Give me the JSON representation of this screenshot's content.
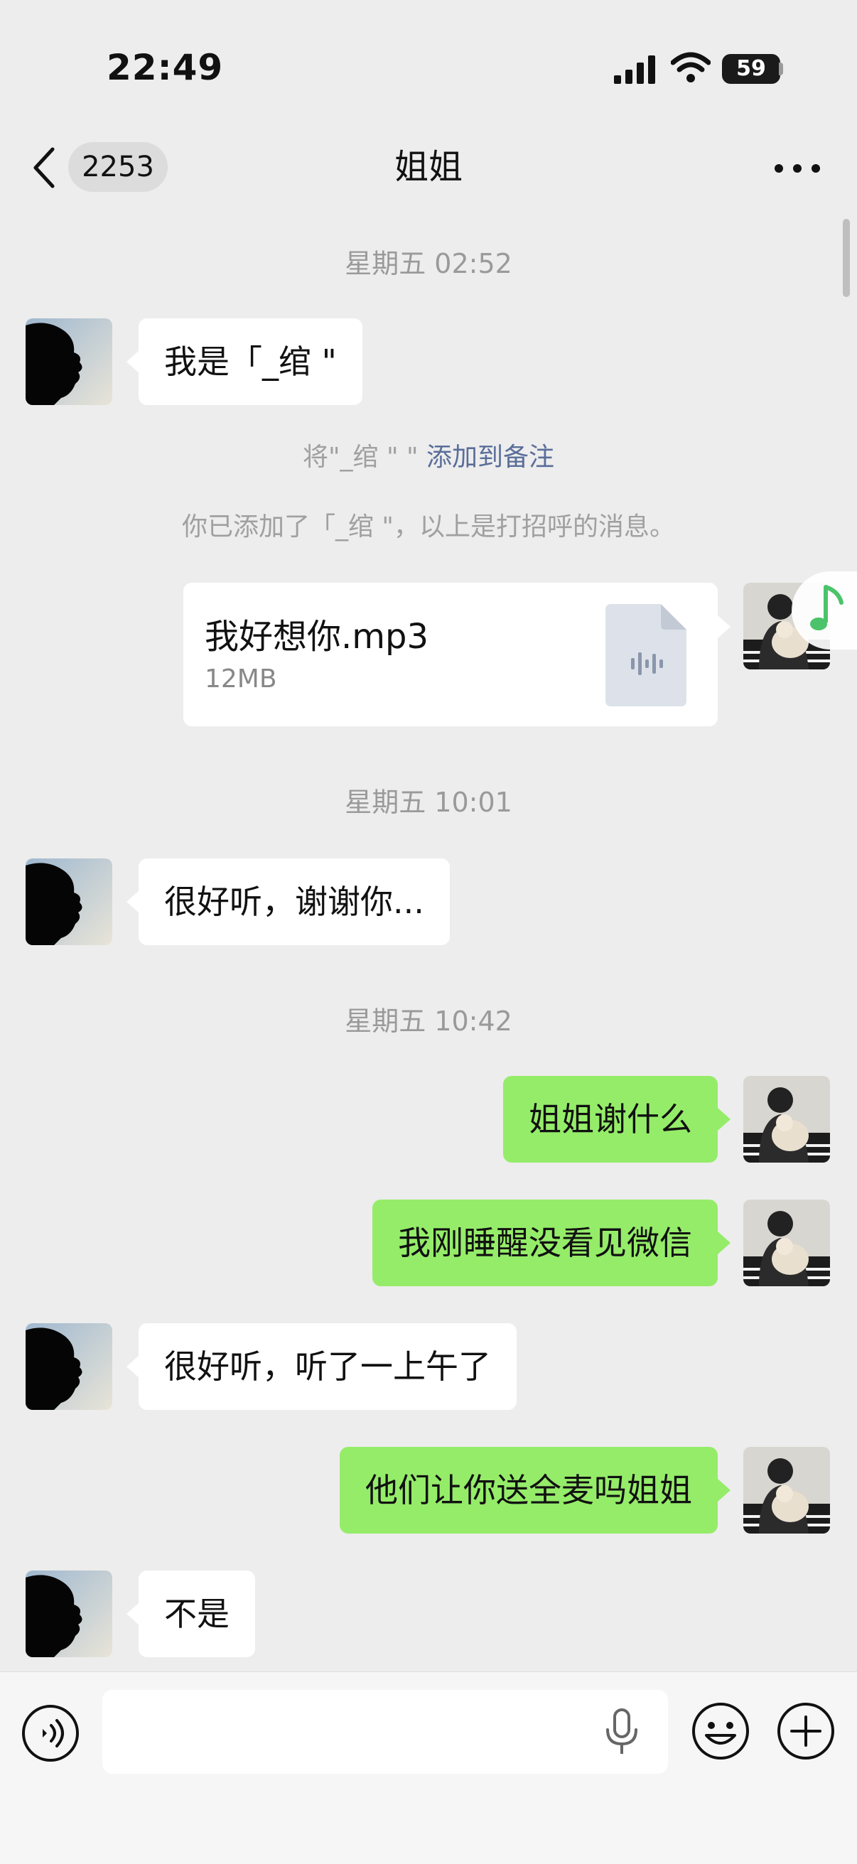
{
  "status_bar": {
    "time": "22:49",
    "battery": "59"
  },
  "header": {
    "unread_count": "2253",
    "title": "姐姐"
  },
  "messages": {
    "ts1": "星期五 02:52",
    "m1": "我是「_绾 \"",
    "sys1_prefix": "将\"_绾 \" \"",
    "sys1_link": "添加到备注",
    "sys2": "你已添加了「_绾 \"，以上是打招呼的消息。",
    "file_name": "我好想你.mp3",
    "file_size": "12MB",
    "ts2": "星期五 10:01",
    "m2": "很好听，谢谢你...",
    "ts3": "星期五 10:42",
    "m3": "姐姐谢什么",
    "m4": "我刚睡醒没看见微信",
    "m5": "很好听，听了一上午了",
    "m6": "他们让你送全麦吗姐姐",
    "m7": "不是"
  },
  "input": {
    "value": "",
    "placeholder": ""
  },
  "icons": [
    "back-icon",
    "more-icon",
    "audio-file-icon",
    "music-note-icon",
    "voice-icon",
    "mic-icon",
    "emoji-icon",
    "plus-icon"
  ],
  "colors": {
    "background": "#ededed",
    "outgoing_bubble": "#95ec69",
    "incoming_bubble": "#ffffff",
    "link": "#5a6e9a"
  }
}
